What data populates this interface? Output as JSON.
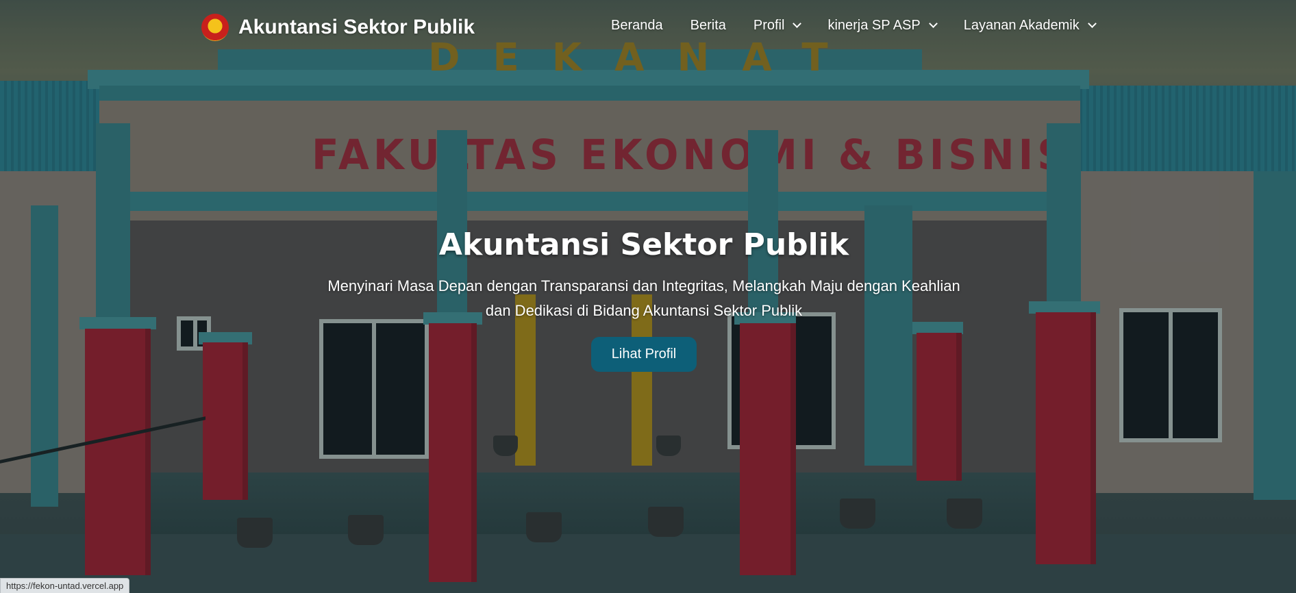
{
  "navbar": {
    "brand_name": "Akuntansi Sektor Publik",
    "logo_icon": "university-emblem-icon",
    "items": [
      {
        "label": "Beranda",
        "has_dropdown": false
      },
      {
        "label": "Berita",
        "has_dropdown": false
      },
      {
        "label": "Profil",
        "has_dropdown": true
      },
      {
        "label": "kinerja SP ASP",
        "has_dropdown": true
      },
      {
        "label": "Layanan Akademik",
        "has_dropdown": true
      }
    ]
  },
  "hero": {
    "title": "Akuntansi Sektor Publik",
    "subtitle": "Menyinari Masa Depan dengan Transparansi dan Integritas, Melangkah Maju dengan Keahlian dan Dedikasi di Bidang Akuntansi Sektor Publik",
    "button_label": "Lihat Profil",
    "background": {
      "sign_top": "DEKANAT",
      "sign_main": "FAKULTAS EKONOMI & BISNIS"
    }
  },
  "status_bar": {
    "url": "https://fekon-untad.vercel.app"
  },
  "colors": {
    "accent_button": "#0d5f78",
    "nav_text": "#ffffff"
  }
}
